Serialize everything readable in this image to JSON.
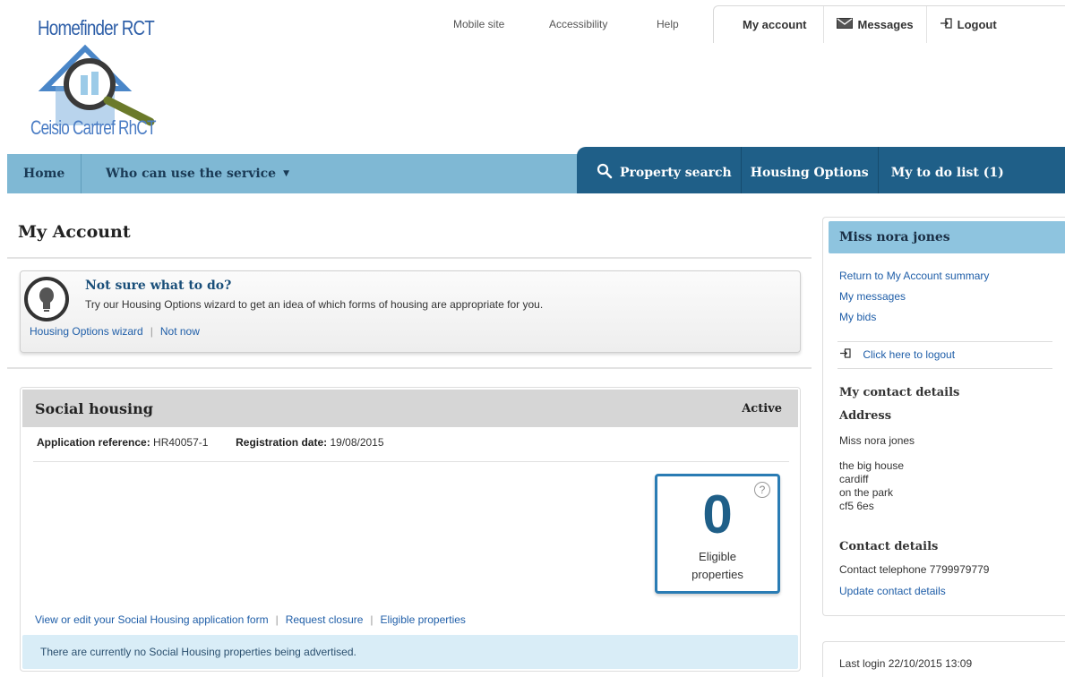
{
  "logo": {
    "title": "Homefinder RCT",
    "subtitle": "Ceisio Cartref RhCT"
  },
  "toplinks": {
    "mobile": "Mobile site",
    "accessibility": "Accessibility",
    "help": "Help"
  },
  "account_tabs": {
    "my_account": "My account",
    "messages": "Messages",
    "logout": "Logout"
  },
  "nav": {
    "home": "Home",
    "who": "Who can use the service",
    "property_search": "Property search",
    "housing_options": "Housing Options",
    "todo": "My to do list (1)"
  },
  "page": {
    "title": "My Account"
  },
  "tip": {
    "title": "Not sure what to do?",
    "text": "Try our Housing Options wizard to get an idea of which forms of housing are appropriate for you.",
    "wizard_link": "Housing Options wizard",
    "not_now_link": "Not now"
  },
  "social": {
    "title": "Social housing",
    "status": "Active",
    "ref_label": "Application reference:",
    "ref_value": "HR40057-1",
    "reg_label": "Registration date:",
    "reg_value": "19/08/2015",
    "eligible_count": "0",
    "eligible_label_1": "Eligible",
    "eligible_label_2": "properties",
    "help_symbol": "?",
    "link_edit": "View or edit your Social Housing application form",
    "link_closure": "Request closure",
    "link_eligible": "Eligible properties",
    "notice": "There are currently no Social Housing properties being advertised."
  },
  "sidebar": {
    "name": "Miss nora jones",
    "links": [
      "Return to My Account summary",
      "My messages",
      "My bids"
    ],
    "logout_link": "Click here to logout",
    "contact_heading": "My contact details",
    "address_heading": "Address",
    "address_name": "Miss nora jones",
    "address_lines": [
      "the big house",
      "cardiff",
      "on the park",
      "cf5 6es"
    ],
    "contact_details_heading": "Contact details",
    "telephone": "Contact telephone 7799979779",
    "update_link": "Update contact details"
  },
  "last_login": "Last login 22/10/2015 13:09",
  "colors": {
    "nav_light": "#7fb8d4",
    "nav_dark": "#1f5f88",
    "link": "#1f5ea8",
    "notice_bg": "#d9edf7"
  }
}
